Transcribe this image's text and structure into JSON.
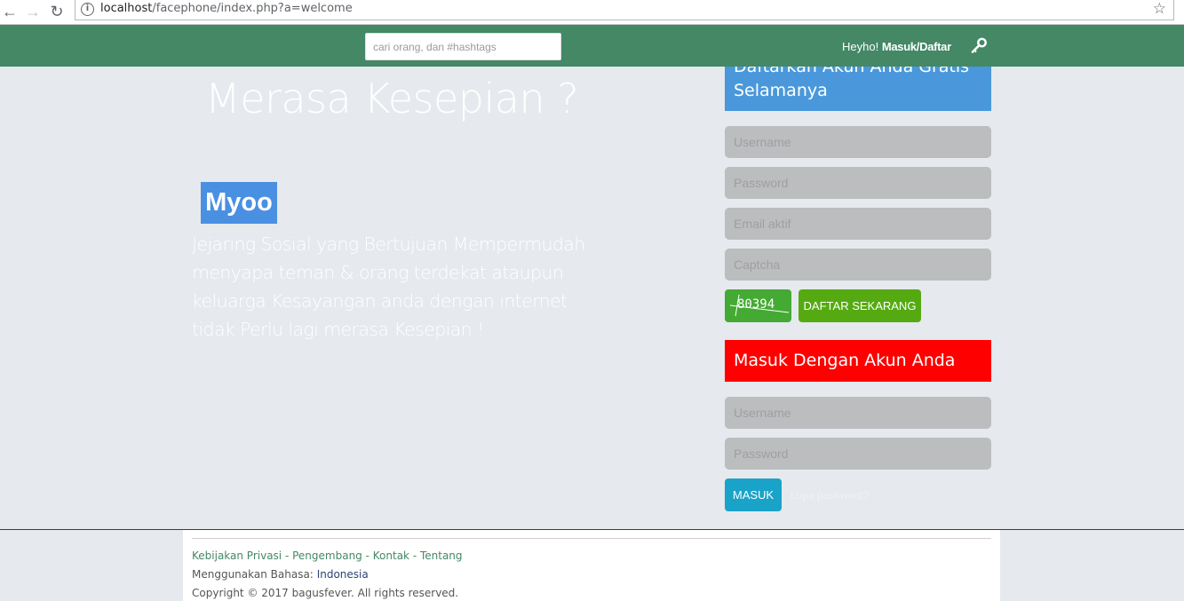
{
  "browser": {
    "url_host": "localhost",
    "url_path": "/facephone/index.php?a=welcome"
  },
  "header": {
    "search_placeholder": "cari orang, dan #hashtags",
    "greeting": "Heyho!",
    "login_link": "Masuk/Daftar",
    "bg_color": "#448866"
  },
  "hero": {
    "title": "Merasa Kesepian ?",
    "brand": "Myoo",
    "description": "Jejaring Sosial yang Bertujuan Mempermudah menyapa teman & orang terdekat ataupun keluarga Kesayangan anda dengan internet tidak Perlu lagi merasa Kesepian !"
  },
  "register": {
    "title": "Daftarkan Akun Anda Gratis Selamanya",
    "username_placeholder": "Username",
    "password_placeholder": "Password",
    "email_placeholder": "Email aktif",
    "captcha_placeholder": "Captcha",
    "captcha_code": "80394",
    "submit_label": "DAFTAR SEKARANG"
  },
  "login": {
    "title": "Masuk Dengan Akun Anda",
    "username_placeholder": "Username",
    "password_placeholder": "Password",
    "submit_label": "MASUK",
    "forgot_label": "Lupa password?"
  },
  "footer": {
    "links": [
      "Kebijakan Privasi",
      "Pengembang",
      "Kontak",
      "Tentang"
    ],
    "separator": " - ",
    "language_label": "Menggunakan Bahasa:",
    "language_value": "Indonesia",
    "copyright": "Copyright © 2017 bagusfever. All rights reserved."
  }
}
